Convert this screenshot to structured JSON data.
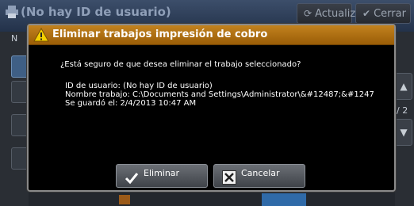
{
  "background": {
    "title": "(No hay ID de usuario)",
    "update_label": "Actualizar",
    "close_label": "Cerrar",
    "left_tab_letter": "N",
    "page_indicator": "/ 2"
  },
  "dialog": {
    "title": "Eliminar trabajos impresión de cobro",
    "question": "¿Está seguro de que desea eliminar el trabajo seleccionado?",
    "user_id_line": "ID de usuario: (No hay ID de usuario)",
    "job_name_line": "Nombre trabajo: C:\\Documents and Settings\\Administrator\\&#12487;&#1247",
    "saved_line": "Se guardó el: 2/4/2013 10:47 AM",
    "delete_label": "Eliminar",
    "cancel_label": "Cancelar"
  },
  "colors": {
    "title_bar": "#b5741a",
    "dialog_bg": "#000000",
    "button_bg": "#55595f",
    "check_icon": "#ffffff"
  }
}
